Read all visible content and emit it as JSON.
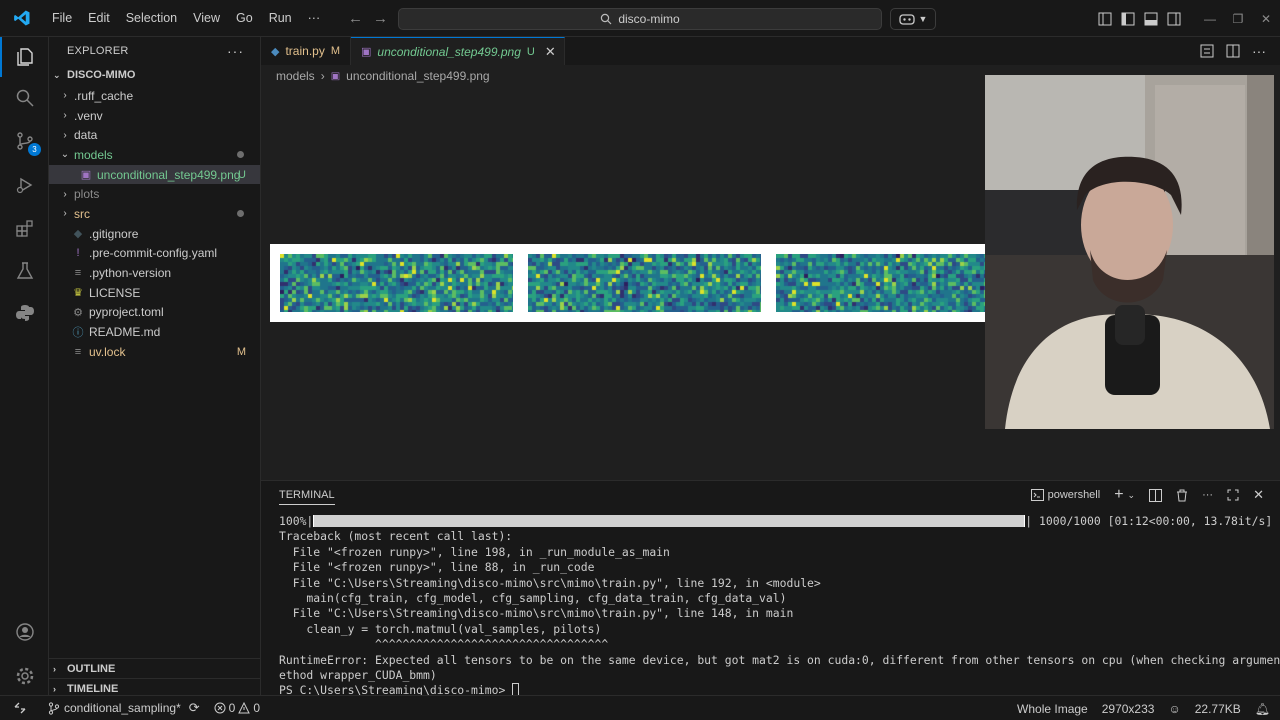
{
  "menu": [
    "File",
    "Edit",
    "Selection",
    "View",
    "Go",
    "Run",
    "···"
  ],
  "search": {
    "text": "disco-mimo"
  },
  "sidebar": {
    "title": "EXPLORER",
    "root": "DISCO-MIMO",
    "items": [
      {
        "label": ".ruff_cache",
        "kind": "folder",
        "status": ""
      },
      {
        "label": ".venv",
        "kind": "folder",
        "status": ""
      },
      {
        "label": "data",
        "kind": "folder",
        "status": ""
      },
      {
        "label": "models",
        "kind": "folder-open",
        "status": ""
      },
      {
        "label": "unconditional_step499.png",
        "kind": "file-png",
        "status": "U"
      },
      {
        "label": "plots",
        "kind": "folder",
        "status": ""
      },
      {
        "label": "src",
        "kind": "folder",
        "status": ""
      },
      {
        "label": ".gitignore",
        "kind": "file-git",
        "status": ""
      },
      {
        "label": ".pre-commit-config.yaml",
        "kind": "file-yaml",
        "status": ""
      },
      {
        "label": ".python-version",
        "kind": "file-text",
        "status": ""
      },
      {
        "label": "LICENSE",
        "kind": "file-license",
        "status": ""
      },
      {
        "label": "pyproject.toml",
        "kind": "file-gear",
        "status": ""
      },
      {
        "label": "README.md",
        "kind": "file-info",
        "status": ""
      },
      {
        "label": "uv.lock",
        "kind": "file-text",
        "status": "M"
      }
    ],
    "outline": "OUTLINE",
    "timeline": "TIMELINE"
  },
  "tabs": [
    {
      "label": "train.py",
      "status": "M"
    },
    {
      "label": "unconditional_step499.png",
      "status": "U"
    }
  ],
  "breadcrumb": {
    "folder": "models",
    "file": "unconditional_step499.png"
  },
  "terminal": {
    "title": "TERMINAL",
    "shell": "powershell",
    "progress_fraction": 1.0,
    "lines": {
      "progress_pct": "100%|",
      "progress_tail": "| 1000/1000 [01:12<00:00, 13.78it/s]",
      "l1": "Traceback (most recent call last):",
      "l2": "  File \"<frozen runpy>\", line 198, in _run_module_as_main",
      "l3": "  File \"<frozen runpy>\", line 88, in _run_code",
      "l4": "  File \"C:\\Users\\Streaming\\disco-mimo\\src\\mimo\\train.py\", line 192, in <module>",
      "l5": "    main(cfg_train, cfg_model, cfg_sampling, cfg_data_train, cfg_data_val)",
      "l6": "  File \"C:\\Users\\Streaming\\disco-mimo\\src\\mimo\\train.py\", line 148, in main",
      "l7": "    clean_y = torch.matmul(val_samples, pilots)",
      "l8": "              ^^^^^^^^^^^^^^^^^^^^^^^^^^^^^^^^^^",
      "l9": "RuntimeError: Expected all tensors to be on the same device, but got mat2 is on cuda:0, different from other tensors on cpu (when checking argument in m",
      "l10": "ethod wrapper_CUDA_bmm)",
      "prompt": "PS C:\\Users\\Streaming\\disco-mimo> "
    }
  },
  "statusbar": {
    "branch": "conditional_sampling*",
    "errors": "0",
    "warnings": "0",
    "mode": "Whole Image",
    "dimensions": "2970x233",
    "filesize": "22.77KB"
  },
  "colors": {
    "accent": "#0078d4",
    "modified": "#e2c08d",
    "untracked": "#73c991",
    "folder_src": "#e2c08d"
  }
}
